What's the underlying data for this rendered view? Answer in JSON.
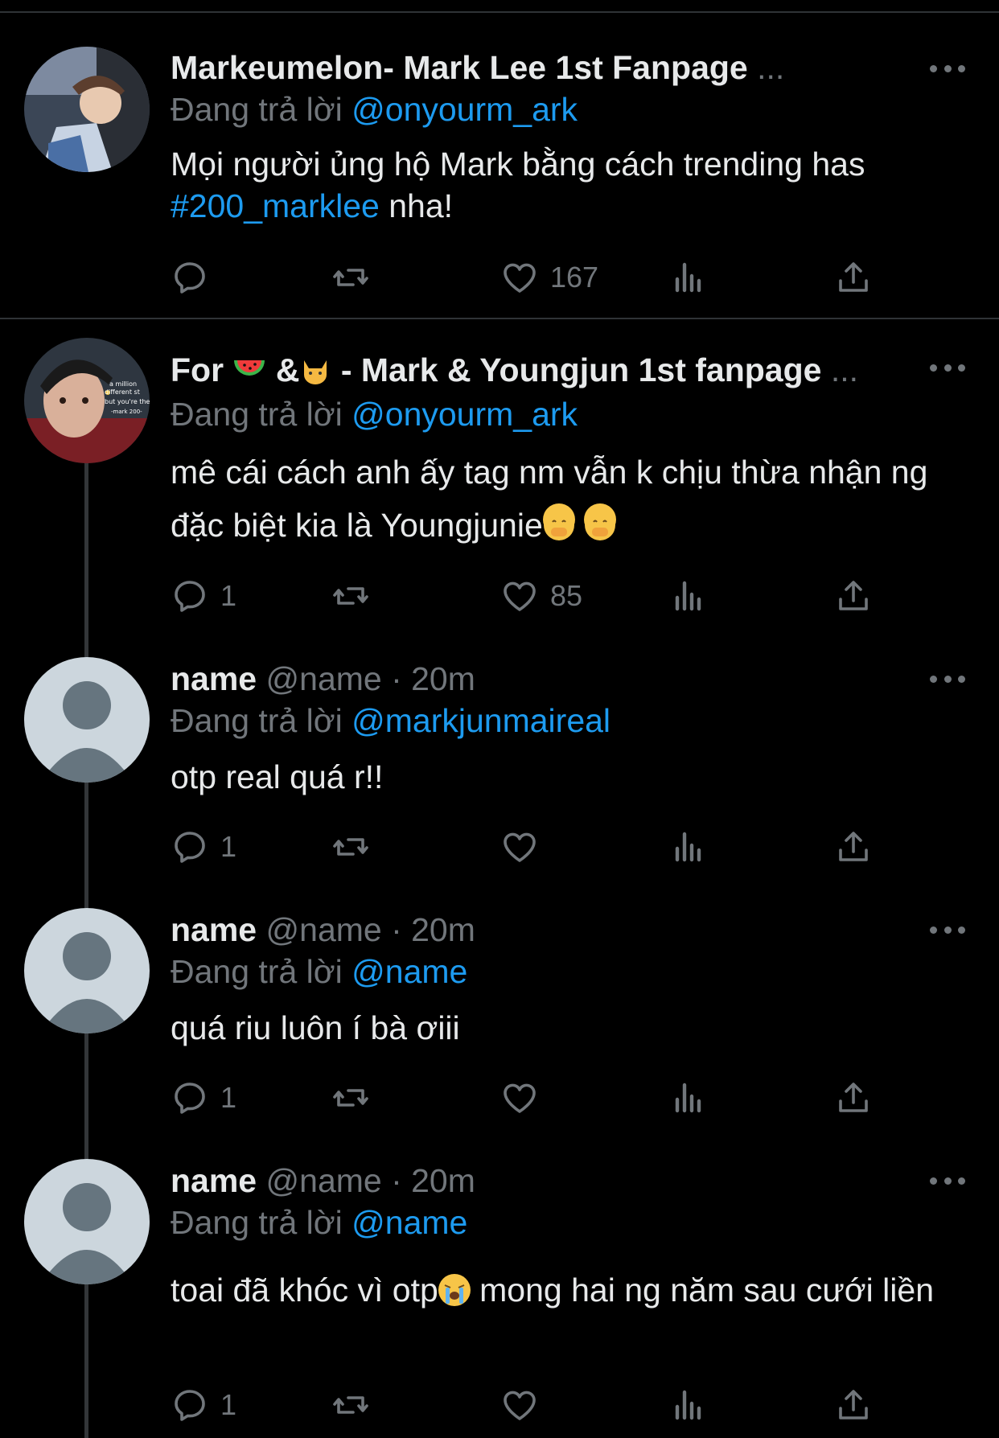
{
  "tweets": [
    {
      "name": "Markeumelon- Mark Lee 1st Fanpage",
      "name_ellipsis": "...",
      "reply_label": "Đang trả lời",
      "reply_to": "@onyourm_ark",
      "text_before_tag": "Mọi người ủng hộ Mark bằng cách trending has ",
      "tag": "#200_marklee",
      "text_after_tag": " nha!",
      "likes": "167"
    },
    {
      "name_prefix": "For ",
      "name_mid": " &",
      "name_suffix": " - Mark & Youngjun 1st fanpage",
      "name_ellipsis": "...",
      "reply_label": "Đang trả lời",
      "reply_to": "@onyourm_ark",
      "text": "mê cái cách anh ấy tag nm vẫn k chịu thừa nhận ng đặc biệt kia là Youngjunie",
      "replies": "1",
      "likes": "85",
      "avatar_caption": "a million different st but you're the -mark 200-"
    },
    {
      "name": "name",
      "handle": "@name · 20m",
      "reply_label": "Đang trả lời",
      "reply_to": "@markjunmaireal",
      "text": "otp real quá r!!",
      "replies": "1"
    },
    {
      "name": "name",
      "handle": "@name · 20m",
      "reply_label": "Đang trả lời",
      "reply_to": "@name",
      "text": "quá riu luôn í bà ơiii",
      "replies": "1"
    },
    {
      "name": "name",
      "handle": "@name · 20m",
      "reply_label": "Đang trả lời",
      "reply_to": "@name",
      "text_before_emoji": "toai đã khóc vì otp",
      "text_after_emoji": " mong hai ng năm sau cưới liền",
      "replies": "1"
    }
  ],
  "icons": [
    "reply-icon",
    "retweet-icon",
    "like-icon",
    "views-icon",
    "share-icon",
    "more-icon"
  ],
  "colors": {
    "background": "#000000",
    "accent": "#1d9bf0",
    "muted": "#71767b",
    "divider": "#2f3336"
  }
}
